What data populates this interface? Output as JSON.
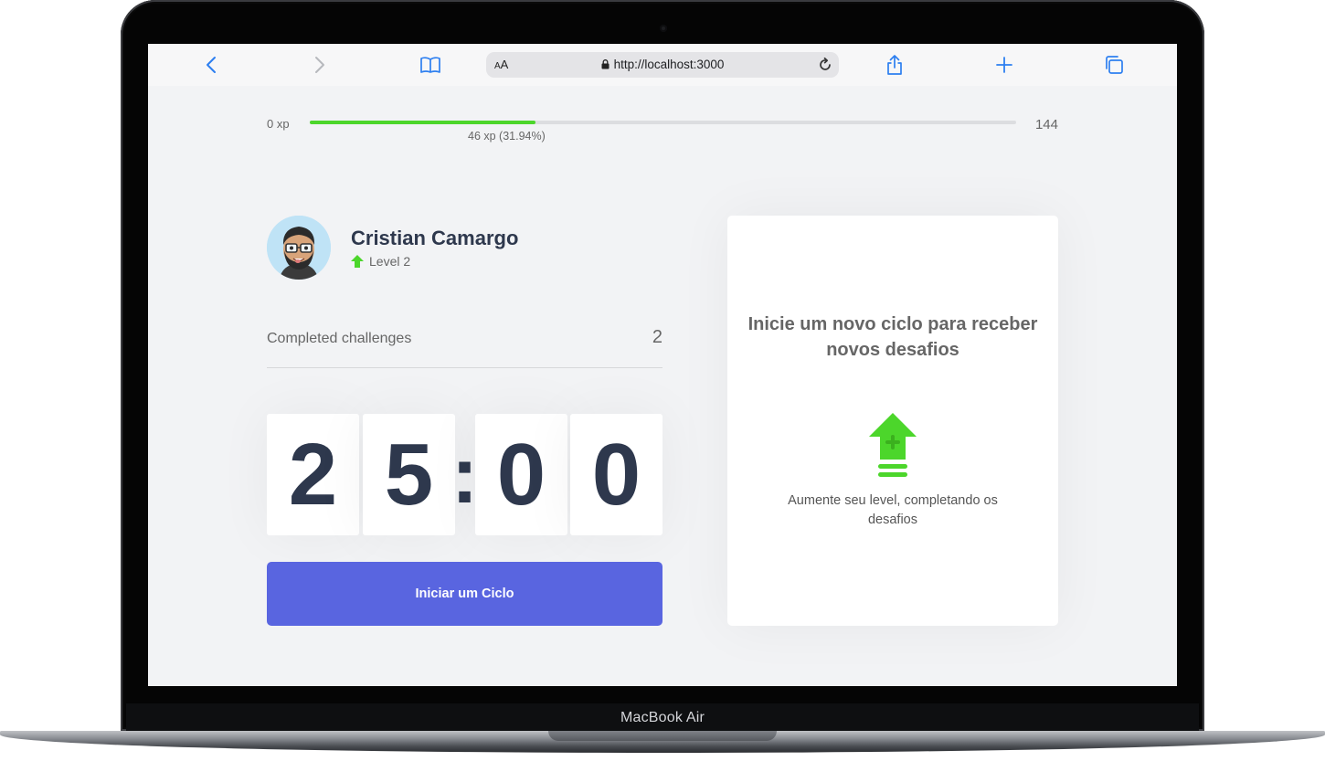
{
  "device": {
    "brand": "MacBook Air"
  },
  "browser": {
    "url": "http://localhost:3000",
    "text_size_label": "AA"
  },
  "experience": {
    "min_label": "0 xp",
    "max_label": "144",
    "current_label": "46 xp (31.94%)",
    "progress_percent": 31.94,
    "accent_color": "#4cd62b"
  },
  "profile": {
    "name": "Cristian Camargo",
    "level_label": "Level 2"
  },
  "challenges": {
    "label": "Completed challenges",
    "value": "2"
  },
  "countdown": {
    "minute_left": "2",
    "minute_right": "5",
    "separator": ":",
    "second_left": "0",
    "second_right": "0"
  },
  "start_button": {
    "label": "Iniciar um Ciclo",
    "color": "#5965e0"
  },
  "challenge_box": {
    "title": "Inicie um novo ciclo para receber novos desafios",
    "description": "Aumente seu level, completando os desafios"
  }
}
